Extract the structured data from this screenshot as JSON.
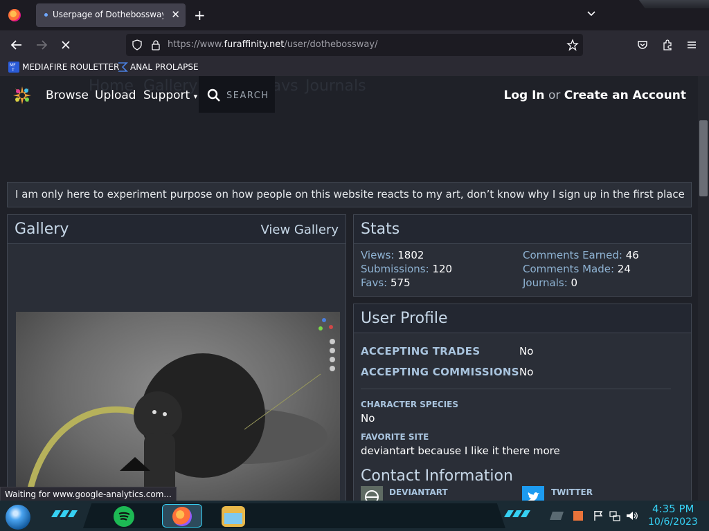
{
  "browser": {
    "tab_title": "Userpage of Dothebossway -- F",
    "tab_close": "✕",
    "new_tab": "+",
    "url_prefix": "https://www.",
    "url_domain": "furaffinity.net",
    "url_path": "/user/dothebossway/",
    "bookmarks": [
      "MEDIAFIRE ROULETTER",
      "ANAL PROLAPSE"
    ],
    "status_text": "Waiting for www.google-analytics.com..."
  },
  "site": {
    "nav": [
      "Browse",
      "Upload",
      "Support"
    ],
    "support_caret": "▾",
    "ghost_nav": [
      "Home",
      "Gallery",
      "Favs",
      "Journals"
    ],
    "search_label": "SEARCH",
    "login": "Log In",
    "or": "or",
    "create": "Create an Account"
  },
  "bio": "I am only here to experiment purpose on how people on this website reacts to my art, don’t know why I sign up in the first place",
  "gallery": {
    "title": "Gallery",
    "link": "View Gallery"
  },
  "stats": {
    "title": "Stats",
    "items": [
      {
        "label": "Views:",
        "value": "1802"
      },
      {
        "label": "Submissions:",
        "value": "120"
      },
      {
        "label": "Favs:",
        "value": "575"
      },
      {
        "label": "Comments Earned:",
        "value": "46"
      },
      {
        "label": "Comments Made:",
        "value": "24"
      },
      {
        "label": "Journals:",
        "value": "0"
      }
    ]
  },
  "profile": {
    "title": "User Profile",
    "rows": [
      {
        "label": "ACCEPTING TRADES",
        "value": "No"
      },
      {
        "label": "ACCEPTING COMMISSIONS",
        "value": "No"
      }
    ],
    "species_label": "CHARACTER SPECIES",
    "species_value": "No",
    "site_label": "FAVORITE SITE",
    "site_value": "deviantart because I like it there more",
    "contact_title": "Contact Information",
    "contacts": [
      "DEVIANTART",
      "TWITTER"
    ]
  },
  "clock": {
    "time": "4:35 PM",
    "date": "10/6/2023"
  },
  "colors": {
    "accent": "#36d0f3",
    "link": "#c7d8e8",
    "label": "#8fb3d3"
  }
}
